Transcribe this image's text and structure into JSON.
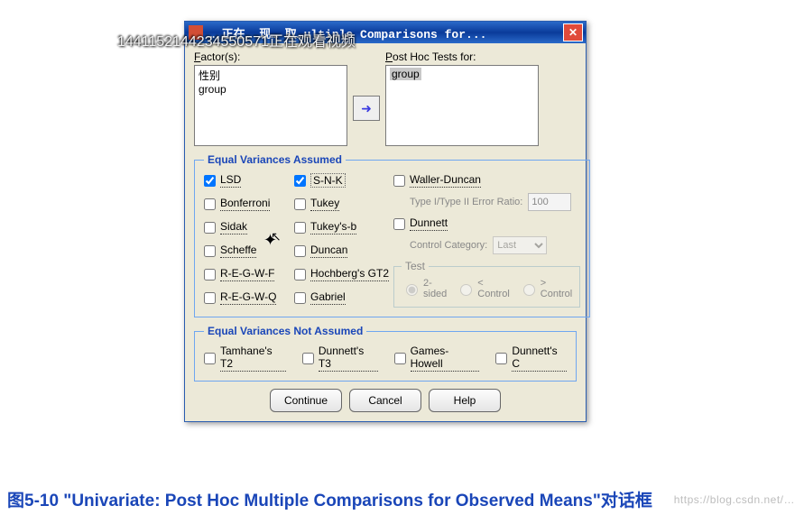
{
  "overlay": "1441152144234550571正在观看视频",
  "titlebar": {
    "title_partial": "ultiple Comparisons for...",
    "title_obscured": "… 正在… 现… 取…"
  },
  "factors": {
    "label": "Factor(s):",
    "items": [
      "性别",
      "group"
    ]
  },
  "posthoc": {
    "label": "Post Hoc Tests for:",
    "items": [
      "group"
    ]
  },
  "equal_var": {
    "legend": "Equal Variances Assumed",
    "col1": [
      {
        "label": "LSD",
        "checked": true
      },
      {
        "label": "Bonferroni",
        "checked": false
      },
      {
        "label": "Sidak",
        "checked": false
      },
      {
        "label": "Scheffe",
        "checked": false
      },
      {
        "label": "R-E-G-W-F",
        "checked": false
      },
      {
        "label": "R-E-G-W-Q",
        "checked": false
      }
    ],
    "col2": [
      {
        "label": "S-N-K",
        "checked": true
      },
      {
        "label": "Tukey",
        "checked": false
      },
      {
        "label": "Tukey's-b",
        "checked": false
      },
      {
        "label": "Duncan",
        "checked": false
      },
      {
        "label": "Hochberg's GT2",
        "checked": false
      },
      {
        "label": "Gabriel",
        "checked": false
      }
    ],
    "waller_duncan": {
      "label": "Waller-Duncan",
      "checked": false
    },
    "ratio_label": "Type I/Type II Error Ratio:",
    "ratio_value": "100",
    "dunnett": {
      "label": "Dunnett",
      "checked": false
    },
    "control_label": "Control Category:",
    "control_value": "Last",
    "test": {
      "legend": "Test",
      "opts": [
        "2-sided",
        "< Control",
        "> Control"
      ],
      "selected": "2-sided"
    }
  },
  "not_assumed": {
    "legend": "Equal Variances Not Assumed",
    "items": [
      {
        "label": "Tamhane's T2",
        "checked": false
      },
      {
        "label": "Dunnett's T3",
        "checked": false
      },
      {
        "label": "Games-Howell",
        "checked": false
      },
      {
        "label": "Dunnett's C",
        "checked": false
      }
    ]
  },
  "buttons": {
    "continue": "Continue",
    "cancel": "Cancel",
    "help": "Help"
  },
  "caption": "图5-10  \"Univariate: Post Hoc Multiple Comparisons for Observed Means\"对话框",
  "watermark": "https://blog.csdn.net/…"
}
